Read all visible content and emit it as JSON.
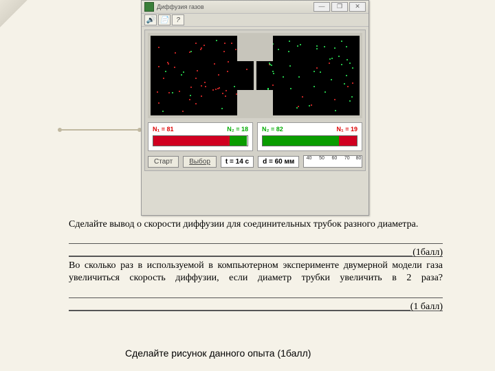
{
  "app": {
    "title": "Диффузия газов",
    "min": "—",
    "max": "❐",
    "close": "✕",
    "help": "?",
    "start": "Старт",
    "choose": "Выбор",
    "time": "t = 14 c",
    "diam": "d = 60 мм",
    "ruler": {
      "t40": "40",
      "t50": "50",
      "t60": "60",
      "t70": "70",
      "t80": "80"
    }
  },
  "meters": {
    "left": {
      "n1_label": "N₁ = 81",
      "n2_label": "N₂ = 18",
      "red": 81,
      "green": 18
    },
    "right": {
      "n2_label": "N₂ = 82",
      "n1_label": "N₁ = 19",
      "green": 82,
      "red": 19
    }
  },
  "chart_data": [
    {
      "type": "bar",
      "title": "Left chamber particle counts",
      "categories": [
        "N₁ (red)",
        "N₂ (green)"
      ],
      "values": [
        81,
        18
      ],
      "ylim": [
        0,
        100
      ]
    },
    {
      "type": "bar",
      "title": "Right chamber particle counts",
      "categories": [
        "N₂ (green)",
        "N₁ (red)"
      ],
      "values": [
        82,
        19
      ],
      "ylim": [
        0,
        100
      ]
    }
  ],
  "text": {
    "q1": "Сделайте вывод о скорости диффузии для соединительных трубок разного диаметра.",
    "score1": "(1балл)",
    "q2": "Во сколько раз в используемой в компьютерном эксперименте двумерной модели газа увеличиться скорость диффузии, если диаметр трубки увеличить в 2 раза?",
    "score2": "(1 балл)",
    "caption": "Сделайте рисунок данного опыта (1балл)"
  }
}
